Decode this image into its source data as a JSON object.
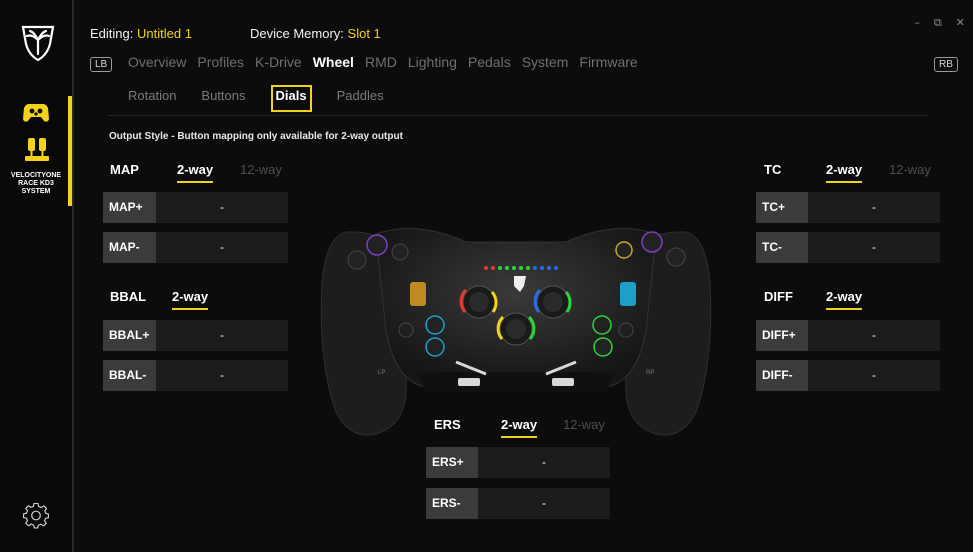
{
  "sidebar": {
    "device_name_line1": "VELOCITYONE",
    "device_name_line2": "RACE KD3",
    "device_name_line3": "SYSTEM",
    "accent": "#f2d21b"
  },
  "header": {
    "editing_label": "Editing:",
    "editing_value": "Untitled 1",
    "memory_label": "Device Memory:",
    "memory_value": "Slot 1"
  },
  "window_controls": {
    "minimize": "–",
    "restore": "⧉",
    "close": "✕"
  },
  "badges": {
    "left": "LB",
    "right": "RB"
  },
  "main_tabs": [
    "Overview",
    "Profiles",
    "K-Drive",
    "Wheel",
    "RMD",
    "Lighting",
    "Pedals",
    "System",
    "Firmware"
  ],
  "sub_tabs": [
    "Rotation",
    "Buttons",
    "Dials",
    "Paddles"
  ],
  "output_style": "Output Style - Button mapping only available for 2-way output",
  "dials": {
    "map": {
      "name": "MAP",
      "opt_2way": "2-way",
      "opt_12way": "12-way",
      "plus": "MAP+",
      "minus": "MAP-",
      "plus_val": "-",
      "minus_val": "-"
    },
    "tc": {
      "name": "TC",
      "opt_2way": "2-way",
      "opt_12way": "12-way",
      "plus": "TC+",
      "minus": "TC-",
      "plus_val": "-",
      "minus_val": "-"
    },
    "bbal": {
      "name": "BBAL",
      "opt_2way": "2-way",
      "plus": "BBAL+",
      "minus": "BBAL-",
      "plus_val": "-",
      "minus_val": "-"
    },
    "diff": {
      "name": "DIFF",
      "opt_2way": "2-way",
      "plus": "DIFF+",
      "minus": "DIFF-",
      "plus_val": "-",
      "minus_val": "-"
    },
    "ers": {
      "name": "ERS",
      "opt_2way": "2-way",
      "opt_12way": "12-way",
      "plus": "ERS+",
      "minus": "ERS-",
      "plus_val": "-",
      "minus_val": "-"
    }
  },
  "wheel_image": {
    "label_lp": "LP",
    "label_rp": "RP"
  },
  "icons": {
    "logo": "turtle-beach-logo-icon",
    "wheel": "wheel-device-icon",
    "pedals": "pedals-device-icon",
    "settings": "gear-icon"
  }
}
